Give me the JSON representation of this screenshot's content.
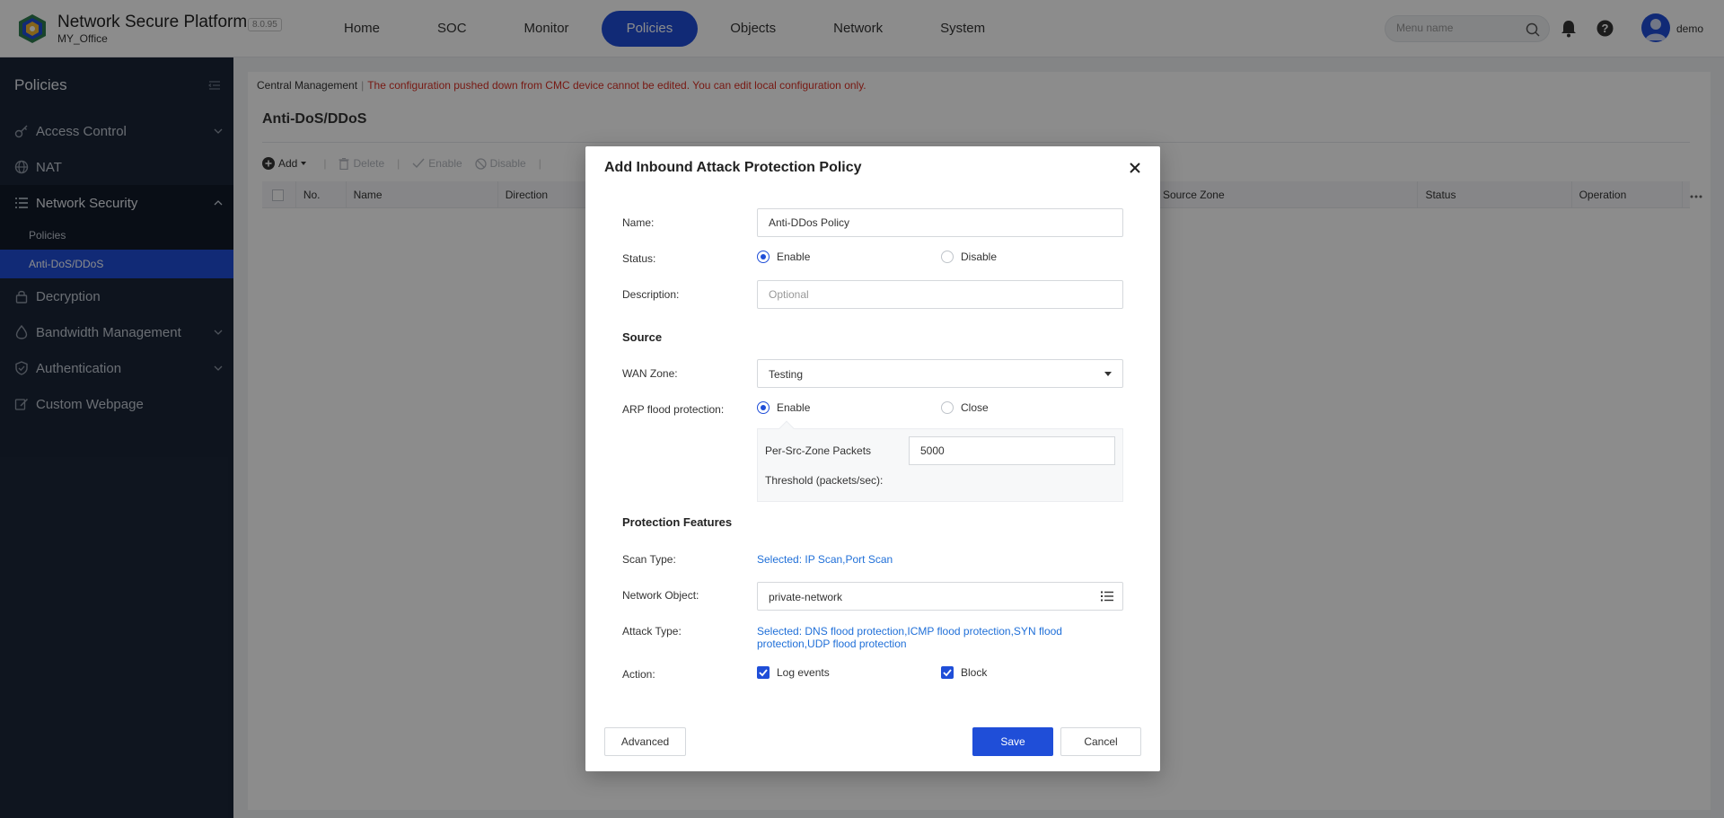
{
  "app": {
    "title": "Network Secure Platform",
    "version": "8.0.95",
    "subtitle": "MY_Office",
    "username": "demo",
    "accent_color": "#1f4ed8"
  },
  "nav": {
    "items": [
      {
        "label": "Home"
      },
      {
        "label": "SOC"
      },
      {
        "label": "Monitor"
      },
      {
        "label": "Policies"
      },
      {
        "label": "Objects"
      },
      {
        "label": "Network"
      },
      {
        "label": "System"
      }
    ],
    "active": "Policies"
  },
  "search": {
    "placeholder": "Menu name"
  },
  "sidebar": {
    "title": "Policies",
    "items": [
      {
        "label": "Access Control",
        "icon": "key-icon"
      },
      {
        "label": "NAT",
        "icon": "globe-icon"
      },
      {
        "label": "Network Security",
        "icon": "list-icon"
      },
      {
        "label": "Decryption",
        "icon": "lock-icon"
      },
      {
        "label": "Bandwidth Management",
        "icon": "drop-icon"
      },
      {
        "label": "Authentication",
        "icon": "shield-icon"
      },
      {
        "label": "Custom Webpage",
        "icon": "edit-icon"
      }
    ],
    "subitems": [
      {
        "label": "Policies"
      },
      {
        "label": "Anti-DoS/DDoS"
      }
    ]
  },
  "notice": {
    "central": "Central Management",
    "message": "The configuration pushed down from CMC device cannot be edited. You can edit local configuration only."
  },
  "page": {
    "title": "Anti-DoS/DDoS"
  },
  "toolbar": {
    "add": "Add",
    "delete": "Delete",
    "enable": "Enable",
    "disable": "Disable"
  },
  "table": {
    "columns": [
      "No.",
      "Name",
      "Direction",
      "Source Zone",
      "Status",
      "Operation"
    ]
  },
  "modal": {
    "title": "Add Inbound Attack Protection Policy",
    "name_label": "Name:",
    "name_value": "Anti-DDos Policy",
    "status_label": "Status:",
    "status_enable": "Enable",
    "status_disable": "Disable",
    "description_label": "Description:",
    "description_placeholder": "Optional",
    "source_section": "Source",
    "wan_label": "WAN Zone:",
    "wan_value": "Testing",
    "arp_label": "ARP flood protection:",
    "arp_enable": "Enable",
    "arp_close": "Close",
    "threshold_label_1": "Per-Src-Zone Packets",
    "threshold_label_2": "Threshold (packets/sec):",
    "threshold_value": "5000",
    "protection_section": "Protection Features",
    "scan_label": "Scan Type:",
    "scan_value": "Selected: IP Scan,Port Scan",
    "network_label": "Network Object:",
    "network_value": "private-network",
    "attack_label": "Attack Type:",
    "attack_value": "Selected: DNS flood protection,ICMP flood protection,SYN flood protection,UDP flood protection",
    "action_label": "Action:",
    "action_log": "Log events",
    "action_block": "Block",
    "advanced_button": "Advanced",
    "save_button": "Save",
    "cancel_button": "Cancel"
  }
}
